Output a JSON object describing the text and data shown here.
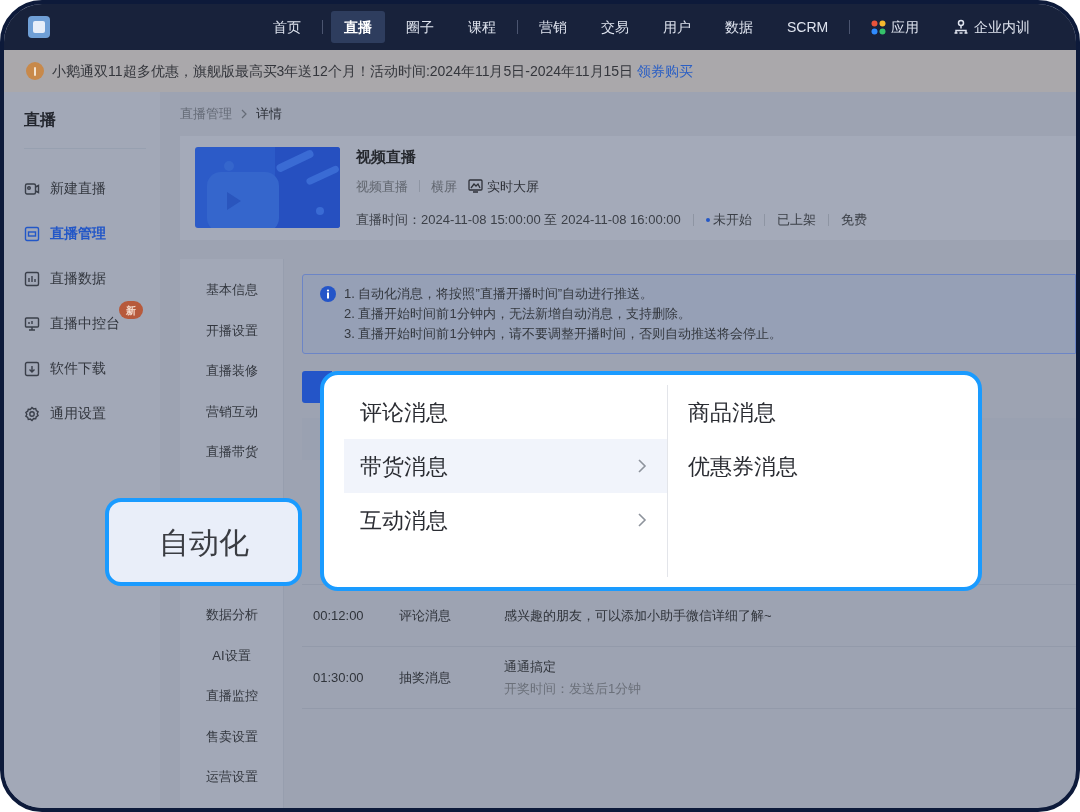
{
  "topnav": {
    "groups": [
      [
        {
          "label": "首页",
          "selected": false
        }
      ],
      [
        {
          "label": "直播",
          "selected": true
        },
        {
          "label": "圈子",
          "selected": false
        },
        {
          "label": "课程",
          "selected": false
        }
      ],
      [
        {
          "label": "营销",
          "selected": false
        },
        {
          "label": "交易",
          "selected": false
        },
        {
          "label": "用户",
          "selected": false
        },
        {
          "label": "数据",
          "selected": false
        },
        {
          "label": "SCRM",
          "selected": false
        }
      ],
      [
        {
          "label": "应用",
          "selected": false,
          "kind": "apps"
        },
        {
          "label": "企业内训",
          "selected": false,
          "kind": "org"
        }
      ]
    ]
  },
  "banner": {
    "text": "小鹅通双11超多优惠，旗舰版最高买3年送12个月！活动时间:2024年11月5日-2024年11月15日",
    "link": "领券购买"
  },
  "sidebar": {
    "title": "直播",
    "items": [
      {
        "label": "新建直播",
        "selected": false,
        "kind": "camera"
      },
      {
        "label": "直播管理",
        "selected": true,
        "kind": "screen"
      },
      {
        "label": "直播数据",
        "selected": false,
        "kind": "chart"
      },
      {
        "label": "直播中控台",
        "selected": false,
        "kind": "monitor",
        "badge": "新"
      },
      {
        "label": "软件下载",
        "selected": false,
        "kind": "download"
      },
      {
        "label": "通用设置",
        "selected": false,
        "kind": "gear"
      }
    ]
  },
  "breadcrumb": [
    "直播管理",
    "详情"
  ],
  "live": {
    "title": "视频直播",
    "type": "视频直播",
    "orientation": "横屏",
    "screen_link": "实时大屏",
    "time_label": "直播时间：",
    "time": "2024-11-08 15:00:00 至 2024-11-08 16:00:00",
    "status": "未开始",
    "shelf": "已上架",
    "price": "免费"
  },
  "subnav": {
    "above": [
      "基本信息",
      "开播设置",
      "直播装修",
      "营销互动",
      "直播带货"
    ],
    "below": [
      "数据分析",
      "AI设置",
      "直播监控",
      "售卖设置",
      "运营设置"
    ]
  },
  "notice": [
    "1. 自动化消息，将按照”直播开播时间”自动进行推送。",
    "2. 直播开始时间前1分钟内，无法新增自动消息，支持删除。",
    "3. 直播开始时间前1分钟内，请不要调整开播时间，否则自动推送将会停止。"
  ],
  "table": {
    "rows": [
      {
        "time": "00:12:00",
        "type": "评论消息",
        "content": "感兴趣的朋友，可以添加小助手微信详细了解~"
      },
      {
        "time": "01:30:00",
        "type": "抽奖消息",
        "content": "通通搞定",
        "note": "开奖时间：发送后1分钟"
      }
    ]
  },
  "popup": {
    "left": [
      {
        "label": "评论消息",
        "selected": false,
        "submenu": false
      },
      {
        "label": "带货消息",
        "selected": true,
        "submenu": true
      },
      {
        "label": "互动消息",
        "selected": false,
        "submenu": true
      }
    ],
    "right": [
      "商品消息",
      "优惠券消息"
    ]
  },
  "callout": "自动化"
}
